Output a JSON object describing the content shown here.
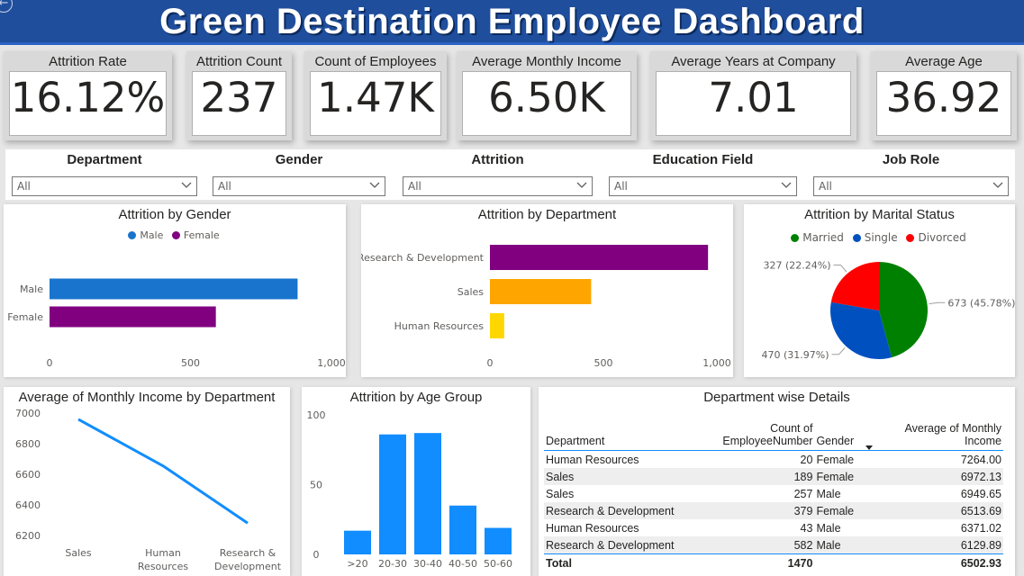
{
  "header": {
    "title": "Green Destination Employee Dashboard",
    "back_icon": "back-arrow-icon"
  },
  "kpis": [
    {
      "label": "Attrition Rate",
      "value": "16.12%"
    },
    {
      "label": "Attrition Count",
      "value": "237"
    },
    {
      "label": "Count of Employees",
      "value": "1.47K"
    },
    {
      "label": "Average Monthly Income",
      "value": "6.50K"
    },
    {
      "label": "Average Years at Company",
      "value": "7.01"
    },
    {
      "label": "Average Age",
      "value": "36.92"
    }
  ],
  "slicers": [
    {
      "label": "Department",
      "value": "All"
    },
    {
      "label": "Gender",
      "value": "All"
    },
    {
      "label": "Attrition",
      "value": "All"
    },
    {
      "label": "Education Field",
      "value": "All"
    },
    {
      "label": "Job Role",
      "value": "All"
    }
  ],
  "colors": {
    "male": "#1874cd",
    "female": "#800080",
    "rd": "#800080",
    "sales": "#ffa500",
    "hr": "#ffd700",
    "married": "#008000",
    "single": "#0050c0",
    "divorced": "#ff0000",
    "line": "#118dff",
    "bars": "#118dff",
    "header": "#1f4e9c"
  },
  "chart_data": [
    {
      "id": "gender",
      "type": "bar",
      "title": "Attrition by Gender",
      "legend": [
        "Male",
        "Female"
      ],
      "categories": [
        "Male",
        "Female"
      ],
      "values": [
        880,
        590
      ],
      "xlim": [
        0,
        1000
      ],
      "xticks": [
        "0",
        "500",
        "1,000"
      ]
    },
    {
      "id": "department",
      "type": "bar",
      "title": "Attrition by Department",
      "categories": [
        "Research & Development",
        "Sales",
        "Human Resources"
      ],
      "values": [
        961,
        446,
        63
      ],
      "xlim": [
        0,
        1000
      ],
      "xticks": [
        "0",
        "500",
        "1,000"
      ]
    },
    {
      "id": "marital",
      "type": "pie",
      "title": "Attrition by Marital Status",
      "legend": [
        "Married",
        "Single",
        "Divorced"
      ],
      "values": [
        673,
        470,
        327
      ],
      "labels": [
        "673 (45.78%)",
        "470 (31.97%)",
        "327 (22.24%)"
      ]
    },
    {
      "id": "income",
      "type": "line",
      "title": "Average of Monthly Income by Department",
      "categories": [
        "Sales",
        "Human Resources",
        "Research & Development"
      ],
      "category_lines": [
        [
          "Sales"
        ],
        [
          "Human",
          "Resources"
        ],
        [
          "Research &",
          "Development"
        ]
      ],
      "values": [
        6959,
        6655,
        6281
      ],
      "ylim": [
        6100,
        7000
      ],
      "yticks": [
        "7000",
        "6800",
        "6600",
        "6400",
        "6200"
      ]
    },
    {
      "id": "age",
      "type": "bar",
      "title": "Attrition by Age Group",
      "categories": [
        ">20",
        "20-30",
        "30-40",
        "40-50",
        "50-60"
      ],
      "values": [
        17,
        86,
        87,
        35,
        19
      ],
      "ylim": [
        0,
        100
      ],
      "yticks": [
        "100",
        "50",
        "0"
      ]
    }
  ],
  "table": {
    "title": "Department wise Details",
    "columns": [
      "Department",
      "Count of EmployeeNumber",
      "Gender",
      "Average of Monthly Income"
    ],
    "rows": [
      [
        "Human Resources",
        "20",
        "Female",
        "7264.00"
      ],
      [
        "Sales",
        "189",
        "Female",
        "6972.13"
      ],
      [
        "Sales",
        "257",
        "Male",
        "6949.65"
      ],
      [
        "Research & Development",
        "379",
        "Female",
        "6513.69"
      ],
      [
        "Human Resources",
        "43",
        "Male",
        "6371.02"
      ],
      [
        "Research & Development",
        "582",
        "Male",
        "6129.89"
      ]
    ],
    "total": [
      "Total",
      "1470",
      "",
      "6502.93"
    ]
  }
}
